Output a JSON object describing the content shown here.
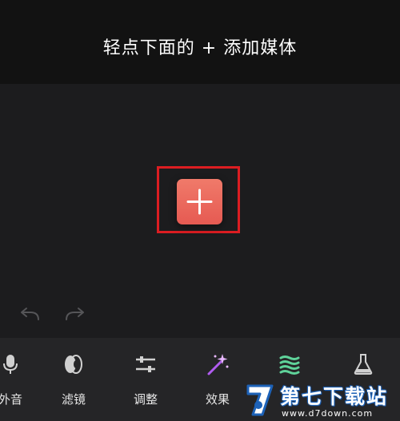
{
  "header": {
    "hint": "轻点下面的 + 添加媒体"
  },
  "canvas": {
    "add_button_icon": "plus-icon",
    "undo_icon": "undo-arrow-icon",
    "redo_icon": "redo-arrow-icon"
  },
  "toolbar": {
    "items": [
      {
        "label": "外音",
        "icon": "microphone-icon"
      },
      {
        "label": "滤镜",
        "icon": "filter-icon"
      },
      {
        "label": "调整",
        "icon": "sliders-icon"
      },
      {
        "label": "效果",
        "icon": "magic-wand-icon"
      },
      {
        "label": "",
        "icon": "audio-wave-icon"
      },
      {
        "label": "",
        "icon": "flask-icon"
      }
    ]
  },
  "watermark": {
    "title": "第七下载站",
    "url": "www.d7down.com"
  },
  "colors": {
    "accent": "#ea6a5e",
    "highlight_border": "#dc1d22",
    "magic_wand": "#b15cf0",
    "audio_wave": "#5fd39a",
    "watermark_blue": "#1d62b8"
  }
}
